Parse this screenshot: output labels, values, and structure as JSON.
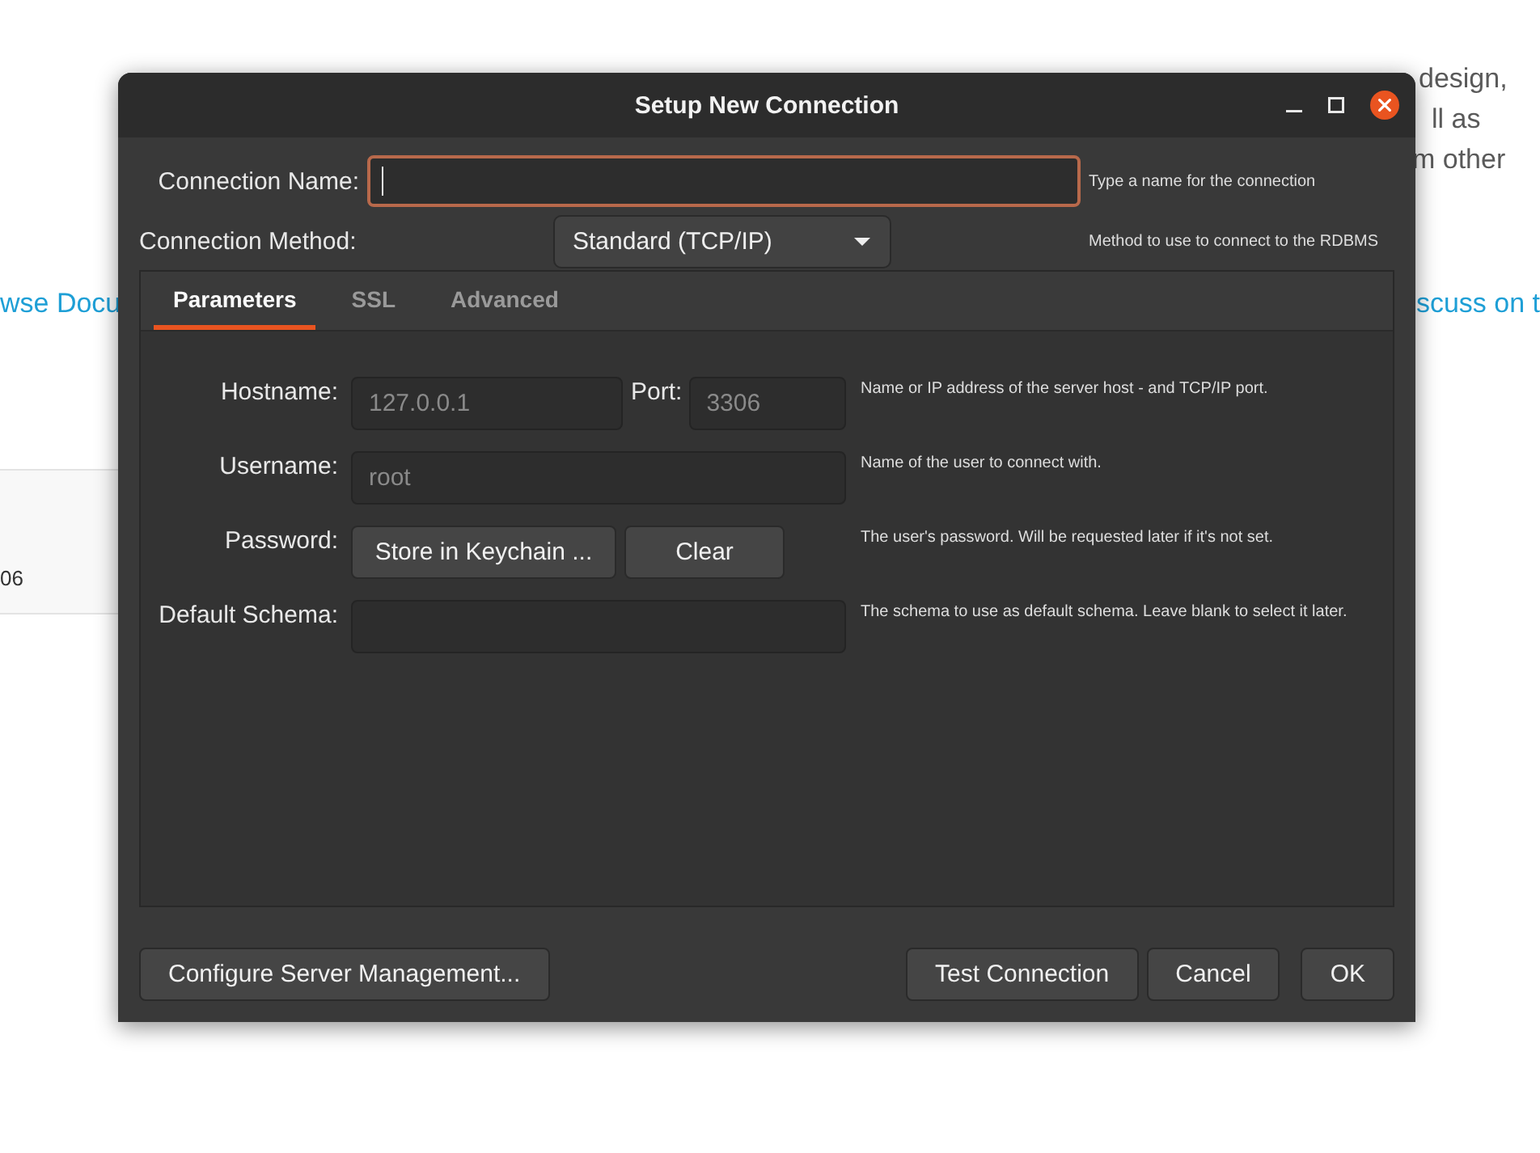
{
  "background_page": {
    "paragraph_fragments": [
      "design,",
      "ll as",
      "m other"
    ],
    "links": [
      "wse Docu",
      "scuss on t"
    ],
    "card": {
      "text": "06"
    }
  },
  "dialog": {
    "title": "Setup New Connection",
    "connection_name": {
      "label": "Connection Name:",
      "focused": true,
      "hint": "Type a name for the connection"
    },
    "connection_method": {
      "label": "Connection Method:",
      "value": "Standard (TCP/IP)",
      "hint": "Method to use to connect to the RDBMS"
    },
    "tabs": [
      {
        "label": "Parameters",
        "selected": true
      },
      {
        "label": "SSL",
        "selected": false
      },
      {
        "label": "Advanced",
        "selected": false
      }
    ],
    "parameters": [
      {
        "kind": "host_port",
        "label": "Hostname:",
        "placeholder": "127.0.0.1",
        "port_label": "Port:",
        "port_placeholder": "3306",
        "hint": "Name or IP address of the server host - and TCP/IP port."
      },
      {
        "kind": "text",
        "label": "Username:",
        "placeholder": "root",
        "hint": "Name of the user to connect with."
      },
      {
        "kind": "buttons",
        "label": "Password:",
        "buttons": [
          "Store in Keychain ...",
          "Clear"
        ],
        "hint": "The user's password. Will be requested later if it's not set."
      },
      {
        "kind": "text",
        "label": "Default Schema:",
        "hint": "The schema to use as default schema. Leave blank to select it later."
      }
    ],
    "footer": {
      "left": [
        "Configure Server Management..."
      ],
      "right": [
        "Test Connection",
        "Cancel",
        "OK"
      ]
    }
  }
}
